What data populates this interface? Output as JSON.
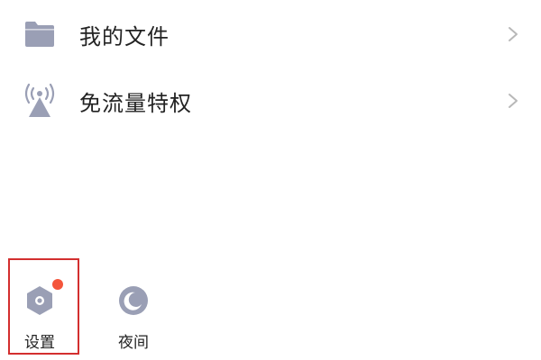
{
  "menu": {
    "items": [
      {
        "label": "我的文件",
        "icon": "folder-icon"
      },
      {
        "label": "免流量特权",
        "icon": "broadcast-tower-icon"
      }
    ]
  },
  "bottom_bar": {
    "settings": {
      "label": "设置",
      "icon": "settings-hexagon-icon",
      "has_badge": true
    },
    "night": {
      "label": "夜间",
      "icon": "moon-icon"
    }
  },
  "colors": {
    "icon_gray": "#9a9fb5",
    "text": "#222222",
    "chevron": "#b8b8b8",
    "badge": "#f4553b",
    "highlight": "#d32f2f"
  }
}
